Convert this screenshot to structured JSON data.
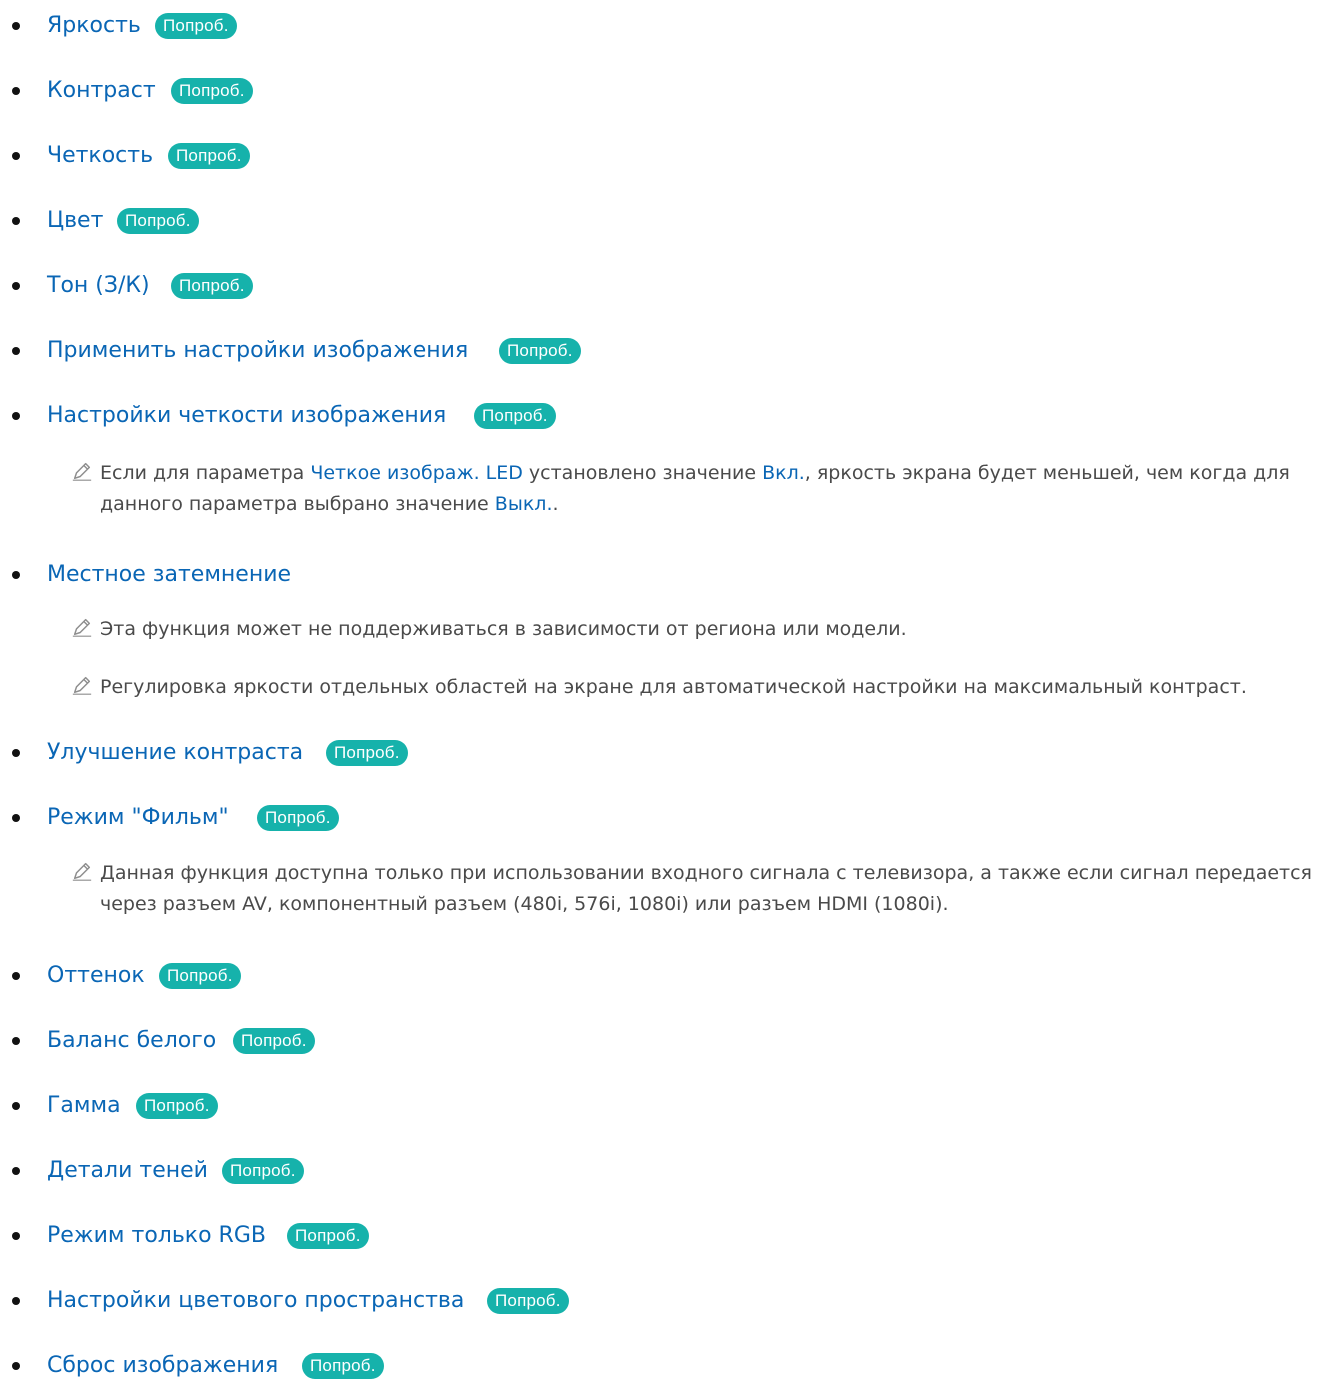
{
  "try_label": "Попроб.",
  "items": [
    {
      "label": "Яркость"
    },
    {
      "label": "Контраст"
    },
    {
      "label": "Четкость"
    },
    {
      "label": "Цвет"
    },
    {
      "label": "Тон (З/К)"
    },
    {
      "label": "Применить настройки изображения"
    },
    {
      "label": "Настройки четкости изображения"
    },
    {
      "note_prefix": "Если для параметра ",
      "note_ref1": "Четкое изображ. LED",
      "note_mid1": " установлено значение ",
      "note_ref2": "Вкл.",
      "note_mid2": ", яркость экрана будет меньшей, чем когда для данного параметра выбрано значение ",
      "note_ref3": "Выкл.",
      "note_suffix": "."
    },
    {
      "label": "Местное затемнение"
    },
    {
      "note": "Эта функция может не поддерживаться в зависимости от региона или модели."
    },
    {
      "note": "Регулировка яркости отдельных областей на экране для автоматической настройки на максимальный контраст."
    },
    {
      "label": "Улучшение контраста"
    },
    {
      "label": "Режим \"Фильм\""
    },
    {
      "note": "Данная функция доступна только при использовании входного сигнала с телевизора, а также если сигнал передается через разъем AV, компонентный разъем (480i, 576i, 1080i) или разъем HDMI (1080i)."
    },
    {
      "label": "Оттенок"
    },
    {
      "label": "Баланс белого"
    },
    {
      "label": "Гамма"
    },
    {
      "label": "Детали теней"
    },
    {
      "label": "Режим только RGB"
    },
    {
      "label": "Настройки цветового пространства"
    },
    {
      "label": "Сброс изображения"
    }
  ],
  "colors": {
    "link": "#0a66b5",
    "try_badge": "#16b2ab",
    "bullet": "#111111",
    "note_text": "#4a4a4a"
  },
  "icons": {
    "note": "pencil-icon",
    "bullet": "bullet-icon"
  }
}
